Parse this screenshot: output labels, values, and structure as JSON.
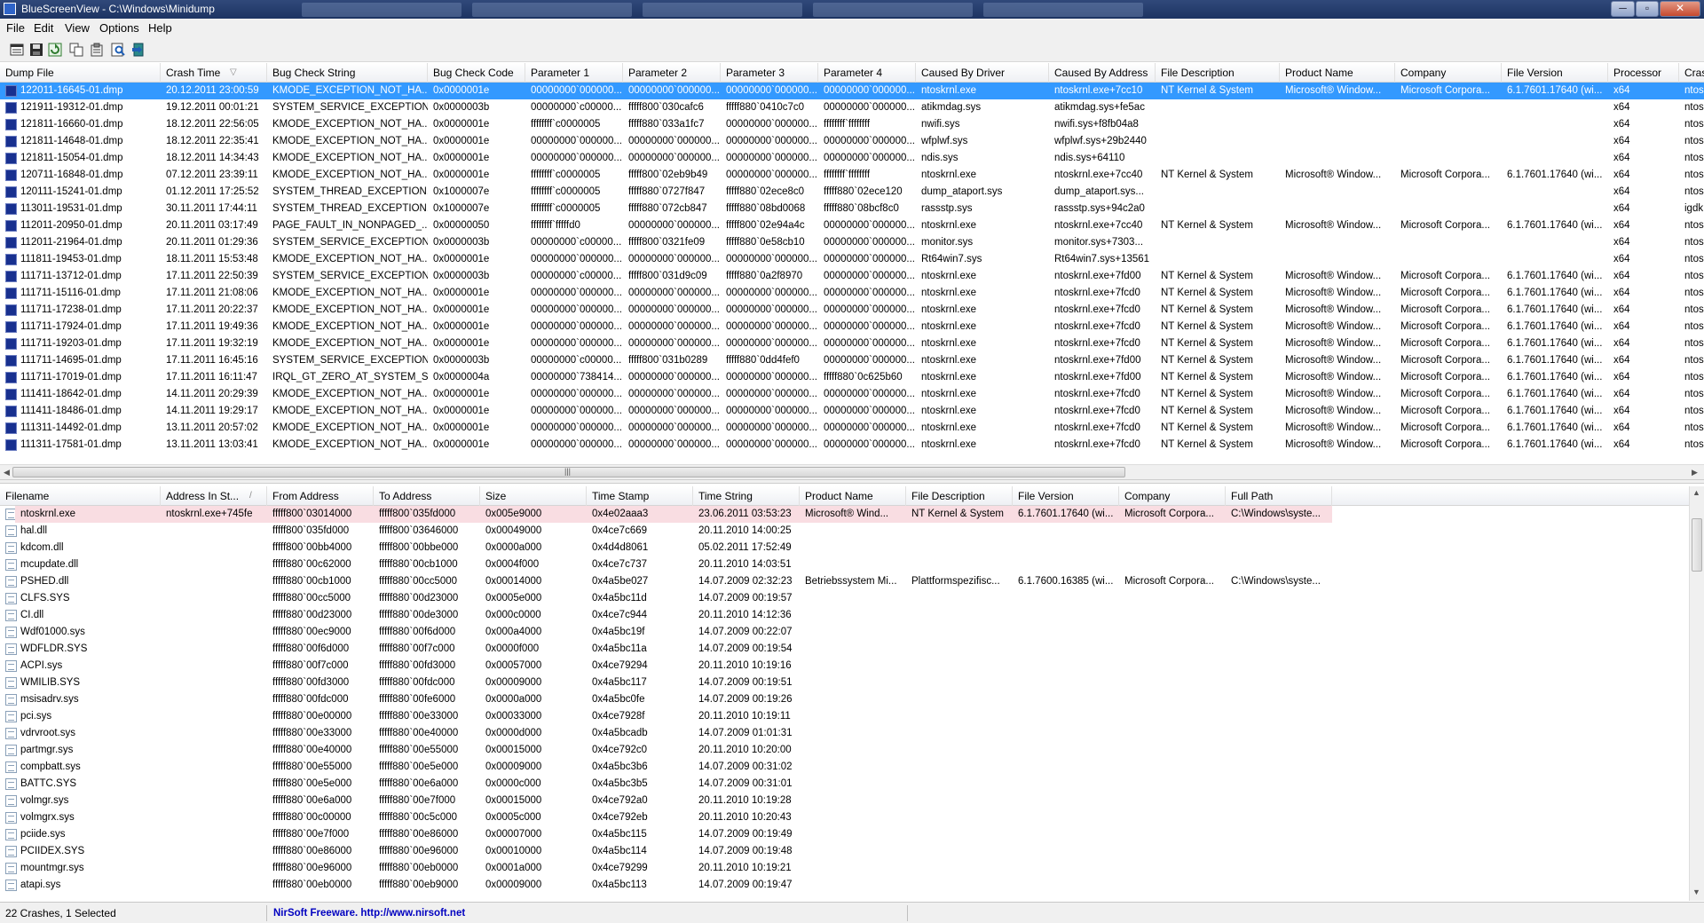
{
  "window": {
    "app_name": "BlueScreenView",
    "path": "C:\\Windows\\Minidump",
    "title_sep": " - "
  },
  "menu": [
    "File",
    "Edit",
    "View",
    "Options",
    "Help"
  ],
  "toolbar": [
    "save-html-report-icon",
    "save-icon",
    "refresh-icon",
    "copy-icon",
    "properties-icon",
    "find-icon",
    "exit-icon"
  ],
  "top_list": {
    "columns": [
      "Dump File",
      "Crash Time",
      "Bug Check String",
      "Bug Check Code",
      "Parameter 1",
      "Parameter 2",
      "Parameter 3",
      "Parameter 4",
      "Caused By Driver",
      "Caused By Address",
      "File Description",
      "Product Name",
      "Company",
      "File Version",
      "Processor",
      "Cras"
    ],
    "sort_indicator": "▽",
    "rows": [
      [
        "122011-16645-01.dmp",
        "20.12.2011 23:00:59",
        "KMODE_EXCEPTION_NOT_HA...",
        "0x0000001e",
        "00000000`000000...",
        "00000000`000000...",
        "00000000`000000...",
        "00000000`000000...",
        "ntoskrnl.exe",
        "ntoskrnl.exe+7cc10",
        "NT Kernel & System",
        "Microsoft® Window...",
        "Microsoft Corpora...",
        "6.1.7601.17640 (wi...",
        "x64",
        "ntos"
      ],
      [
        "121911-19312-01.dmp",
        "19.12.2011 00:01:21",
        "SYSTEM_SERVICE_EXCEPTION",
        "0x0000003b",
        "00000000`c00000...",
        "fffff800`030cafc6",
        "fffff880`0410c7c0",
        "00000000`000000...",
        "atikmdag.sys",
        "atikmdag.sys+fe5ac",
        "",
        "",
        "",
        "",
        "x64",
        "ntos"
      ],
      [
        "121811-16660-01.dmp",
        "18.12.2011 22:56:05",
        "KMODE_EXCEPTION_NOT_HA...",
        "0x0000001e",
        "ffffffff`c0000005",
        "fffff880`033a1fc7",
        "00000000`000000...",
        "ffffffff`ffffffff",
        "nwifi.sys",
        "nwifi.sys+f8fb04a8",
        "",
        "",
        "",
        "",
        "x64",
        "ntos"
      ],
      [
        "121811-14648-01.dmp",
        "18.12.2011 22:35:41",
        "KMODE_EXCEPTION_NOT_HA...",
        "0x0000001e",
        "00000000`000000...",
        "00000000`000000...",
        "00000000`000000...",
        "00000000`000000...",
        "wfplwf.sys",
        "wfplwf.sys+29b2440",
        "",
        "",
        "",
        "",
        "x64",
        "ntos"
      ],
      [
        "121811-15054-01.dmp",
        "18.12.2011 14:34:43",
        "KMODE_EXCEPTION_NOT_HA...",
        "0x0000001e",
        "00000000`000000...",
        "00000000`000000...",
        "00000000`000000...",
        "00000000`000000...",
        "ndis.sys",
        "ndis.sys+64110",
        "",
        "",
        "",
        "",
        "x64",
        "ntos"
      ],
      [
        "120711-16848-01.dmp",
        "07.12.2011 23:39:11",
        "KMODE_EXCEPTION_NOT_HA...",
        "0x0000001e",
        "ffffffff`c0000005",
        "fffff800`02eb9b49",
        "00000000`000000...",
        "ffffffff`ffffffff",
        "ntoskrnl.exe",
        "ntoskrnl.exe+7cc40",
        "NT Kernel & System",
        "Microsoft® Window...",
        "Microsoft Corpora...",
        "6.1.7601.17640 (wi...",
        "x64",
        "ntos"
      ],
      [
        "120111-15241-01.dmp",
        "01.12.2011 17:25:52",
        "SYSTEM_THREAD_EXCEPTION...",
        "0x1000007e",
        "ffffffff`c0000005",
        "fffff880`0727f847",
        "fffff880`02ece8c0",
        "fffff880`02ece120",
        "dump_ataport.sys",
        "dump_ataport.sys...",
        "",
        "",
        "",
        "",
        "x64",
        "ntos"
      ],
      [
        "113011-19531-01.dmp",
        "30.11.2011 17:44:11",
        "SYSTEM_THREAD_EXCEPTION...",
        "0x1000007e",
        "ffffffff`c0000005",
        "fffff880`072cb847",
        "fffff880`08bd0068",
        "fffff880`08bcf8c0",
        "rassstp.sys",
        "rassstp.sys+94c2a0",
        "",
        "",
        "",
        "",
        "x64",
        "igdk"
      ],
      [
        "112011-20950-01.dmp",
        "20.11.2011 03:17:49",
        "PAGE_FAULT_IN_NONPAGED_...",
        "0x00000050",
        "ffffffff`fffffd0",
        "00000000`000000...",
        "fffff800`02e94a4c",
        "00000000`000000...",
        "ntoskrnl.exe",
        "ntoskrnl.exe+7cc40",
        "NT Kernel & System",
        "Microsoft® Window...",
        "Microsoft Corpora...",
        "6.1.7601.17640 (wi...",
        "x64",
        "ntos"
      ],
      [
        "112011-21964-01.dmp",
        "20.11.2011 01:29:36",
        "SYSTEM_SERVICE_EXCEPTION",
        "0x0000003b",
        "00000000`c00000...",
        "fffff800`0321fe09",
        "fffff880`0e58cb10",
        "00000000`000000...",
        "monitor.sys",
        "monitor.sys+7303...",
        "",
        "",
        "",
        "",
        "x64",
        "ntos"
      ],
      [
        "111811-19453-01.dmp",
        "18.11.2011 15:53:48",
        "KMODE_EXCEPTION_NOT_HA...",
        "0x0000001e",
        "00000000`000000...",
        "00000000`000000...",
        "00000000`000000...",
        "00000000`000000...",
        "Rt64win7.sys",
        "Rt64win7.sys+13561",
        "",
        "",
        "",
        "",
        "x64",
        "ntos"
      ],
      [
        "111711-13712-01.dmp",
        "17.11.2011 22:50:39",
        "SYSTEM_SERVICE_EXCEPTION",
        "0x0000003b",
        "00000000`c00000...",
        "fffff800`031d9c09",
        "fffff880`0a2f8970",
        "00000000`000000...",
        "ntoskrnl.exe",
        "ntoskrnl.exe+7fd00",
        "NT Kernel & System",
        "Microsoft® Window...",
        "Microsoft Corpora...",
        "6.1.7601.17640 (wi...",
        "x64",
        "ntos"
      ],
      [
        "111711-15116-01.dmp",
        "17.11.2011 21:08:06",
        "KMODE_EXCEPTION_NOT_HA...",
        "0x0000001e",
        "00000000`000000...",
        "00000000`000000...",
        "00000000`000000...",
        "00000000`000000...",
        "ntoskrnl.exe",
        "ntoskrnl.exe+7fcd0",
        "NT Kernel & System",
        "Microsoft® Window...",
        "Microsoft Corpora...",
        "6.1.7601.17640 (wi...",
        "x64",
        "ntos"
      ],
      [
        "111711-17238-01.dmp",
        "17.11.2011 20:22:37",
        "KMODE_EXCEPTION_NOT_HA...",
        "0x0000001e",
        "00000000`000000...",
        "00000000`000000...",
        "00000000`000000...",
        "00000000`000000...",
        "ntoskrnl.exe",
        "ntoskrnl.exe+7fcd0",
        "NT Kernel & System",
        "Microsoft® Window...",
        "Microsoft Corpora...",
        "6.1.7601.17640 (wi...",
        "x64",
        "ntos"
      ],
      [
        "111711-17924-01.dmp",
        "17.11.2011 19:49:36",
        "KMODE_EXCEPTION_NOT_HA...",
        "0x0000001e",
        "00000000`000000...",
        "00000000`000000...",
        "00000000`000000...",
        "00000000`000000...",
        "ntoskrnl.exe",
        "ntoskrnl.exe+7fcd0",
        "NT Kernel & System",
        "Microsoft® Window...",
        "Microsoft Corpora...",
        "6.1.7601.17640 (wi...",
        "x64",
        "ntos"
      ],
      [
        "111711-19203-01.dmp",
        "17.11.2011 19:32:19",
        "KMODE_EXCEPTION_NOT_HA...",
        "0x0000001e",
        "00000000`000000...",
        "00000000`000000...",
        "00000000`000000...",
        "00000000`000000...",
        "ntoskrnl.exe",
        "ntoskrnl.exe+7fcd0",
        "NT Kernel & System",
        "Microsoft® Window...",
        "Microsoft Corpora...",
        "6.1.7601.17640 (wi...",
        "x64",
        "ntos"
      ],
      [
        "111711-14695-01.dmp",
        "17.11.2011 16:45:16",
        "SYSTEM_SERVICE_EXCEPTION",
        "0x0000003b",
        "00000000`c00000...",
        "fffff800`031b0289",
        "fffff880`0dd4fef0",
        "00000000`000000...",
        "ntoskrnl.exe",
        "ntoskrnl.exe+7fd00",
        "NT Kernel & System",
        "Microsoft® Window...",
        "Microsoft Corpora...",
        "6.1.7601.17640 (wi...",
        "x64",
        "ntos"
      ],
      [
        "111711-17019-01.dmp",
        "17.11.2011 16:11:47",
        "IRQL_GT_ZERO_AT_SYSTEM_S...",
        "0x0000004a",
        "00000000`738414...",
        "00000000`000000...",
        "00000000`000000...",
        "fffff880`0c625b60",
        "ntoskrnl.exe",
        "ntoskrnl.exe+7fd00",
        "NT Kernel & System",
        "Microsoft® Window...",
        "Microsoft Corpora...",
        "6.1.7601.17640 (wi...",
        "x64",
        "ntos"
      ],
      [
        "111411-18642-01.dmp",
        "14.11.2011 20:29:39",
        "KMODE_EXCEPTION_NOT_HA...",
        "0x0000001e",
        "00000000`000000...",
        "00000000`000000...",
        "00000000`000000...",
        "00000000`000000...",
        "ntoskrnl.exe",
        "ntoskrnl.exe+7fcd0",
        "NT Kernel & System",
        "Microsoft® Window...",
        "Microsoft Corpora...",
        "6.1.7601.17640 (wi...",
        "x64",
        "ntos"
      ],
      [
        "111411-18486-01.dmp",
        "14.11.2011 19:29:17",
        "KMODE_EXCEPTION_NOT_HA...",
        "0x0000001e",
        "00000000`000000...",
        "00000000`000000...",
        "00000000`000000...",
        "00000000`000000...",
        "ntoskrnl.exe",
        "ntoskrnl.exe+7fcd0",
        "NT Kernel & System",
        "Microsoft® Window...",
        "Microsoft Corpora...",
        "6.1.7601.17640 (wi...",
        "x64",
        "ntos"
      ],
      [
        "111311-14492-01.dmp",
        "13.11.2011 20:57:02",
        "KMODE_EXCEPTION_NOT_HA...",
        "0x0000001e",
        "00000000`000000...",
        "00000000`000000...",
        "00000000`000000...",
        "00000000`000000...",
        "ntoskrnl.exe",
        "ntoskrnl.exe+7fcd0",
        "NT Kernel & System",
        "Microsoft® Window...",
        "Microsoft Corpora...",
        "6.1.7601.17640 (wi...",
        "x64",
        "ntos"
      ],
      [
        "111311-17581-01.dmp",
        "13.11.2011 13:03:41",
        "KMODE_EXCEPTION_NOT_HA...",
        "0x0000001e",
        "00000000`000000...",
        "00000000`000000...",
        "00000000`000000...",
        "00000000`000000...",
        "ntoskrnl.exe",
        "ntoskrnl.exe+7fcd0",
        "NT Kernel & System",
        "Microsoft® Window...",
        "Microsoft Corpora...",
        "6.1.7601.17640 (wi...",
        "x64",
        "ntos"
      ]
    ]
  },
  "bottom_list": {
    "columns": [
      "Filename",
      "Address In St...",
      "From Address",
      "To Address",
      "Size",
      "Time Stamp",
      "Time String",
      "Product Name",
      "File Description",
      "File Version",
      "Company",
      "Full Path"
    ],
    "sort_indicator": "/",
    "rows": [
      [
        "ntoskrnl.exe",
        "ntoskrnl.exe+745fe",
        "fffff800`03014000",
        "fffff800`035fd000",
        "0x005e9000",
        "0x4e02aaa3",
        "23.06.2011 03:53:23",
        "Microsoft® Wind...",
        "NT Kernel & System",
        "6.1.7601.17640 (wi...",
        "Microsoft Corpora...",
        "C:\\Windows\\syste..."
      ],
      [
        "hal.dll",
        "",
        "fffff800`035fd000",
        "fffff800`03646000",
        "0x00049000",
        "0x4ce7c669",
        "20.11.2010 14:00:25",
        "",
        "",
        "",
        "",
        ""
      ],
      [
        "kdcom.dll",
        "",
        "fffff800`00bb4000",
        "fffff800`00bbe000",
        "0x0000a000",
        "0x4d4d8061",
        "05.02.2011 17:52:49",
        "",
        "",
        "",
        "",
        ""
      ],
      [
        "mcupdate.dll",
        "",
        "fffff880`00c62000",
        "fffff880`00cb1000",
        "0x0004f000",
        "0x4ce7c737",
        "20.11.2010 14:03:51",
        "",
        "",
        "",
        "",
        ""
      ],
      [
        "PSHED.dll",
        "",
        "fffff880`00cb1000",
        "fffff880`00cc5000",
        "0x00014000",
        "0x4a5be027",
        "14.07.2009 02:32:23",
        "Betriebssystem Mi...",
        "Plattformspezifisc...",
        "6.1.7600.16385 (wi...",
        "Microsoft Corpora...",
        "C:\\Windows\\syste..."
      ],
      [
        "CLFS.SYS",
        "",
        "fffff880`00cc5000",
        "fffff880`00d23000",
        "0x0005e000",
        "0x4a5bc11d",
        "14.07.2009 00:19:57",
        "",
        "",
        "",
        "",
        ""
      ],
      [
        "CI.dll",
        "",
        "fffff880`00d23000",
        "fffff880`00de3000",
        "0x000c0000",
        "0x4ce7c944",
        "20.11.2010 14:12:36",
        "",
        "",
        "",
        "",
        ""
      ],
      [
        "Wdf01000.sys",
        "",
        "fffff880`00ec9000",
        "fffff880`00f6d000",
        "0x000a4000",
        "0x4a5bc19f",
        "14.07.2009 00:22:07",
        "",
        "",
        "",
        "",
        ""
      ],
      [
        "WDFLDR.SYS",
        "",
        "fffff880`00f6d000",
        "fffff880`00f7c000",
        "0x0000f000",
        "0x4a5bc11a",
        "14.07.2009 00:19:54",
        "",
        "",
        "",
        "",
        ""
      ],
      [
        "ACPI.sys",
        "",
        "fffff880`00f7c000",
        "fffff880`00fd3000",
        "0x00057000",
        "0x4ce79294",
        "20.11.2010 10:19:16",
        "",
        "",
        "",
        "",
        ""
      ],
      [
        "WMILIB.SYS",
        "",
        "fffff880`00fd3000",
        "fffff880`00fdc000",
        "0x00009000",
        "0x4a5bc117",
        "14.07.2009 00:19:51",
        "",
        "",
        "",
        "",
        ""
      ],
      [
        "msisadrv.sys",
        "",
        "fffff880`00fdc000",
        "fffff880`00fe6000",
        "0x0000a000",
        "0x4a5bc0fe",
        "14.07.2009 00:19:26",
        "",
        "",
        "",
        "",
        ""
      ],
      [
        "pci.sys",
        "",
        "fffff880`00e00000",
        "fffff880`00e33000",
        "0x00033000",
        "0x4ce7928f",
        "20.11.2010 10:19:11",
        "",
        "",
        "",
        "",
        ""
      ],
      [
        "vdrvroot.sys",
        "",
        "fffff880`00e33000",
        "fffff880`00e40000",
        "0x0000d000",
        "0x4a5bcadb",
        "14.07.2009 01:01:31",
        "",
        "",
        "",
        "",
        ""
      ],
      [
        "partmgr.sys",
        "",
        "fffff880`00e40000",
        "fffff880`00e55000",
        "0x00015000",
        "0x4ce792c0",
        "20.11.2010 10:20:00",
        "",
        "",
        "",
        "",
        ""
      ],
      [
        "compbatt.sys",
        "",
        "fffff880`00e55000",
        "fffff880`00e5e000",
        "0x00009000",
        "0x4a5bc3b6",
        "14.07.2009 00:31:02",
        "",
        "",
        "",
        "",
        ""
      ],
      [
        "BATTC.SYS",
        "",
        "fffff880`00e5e000",
        "fffff880`00e6a000",
        "0x0000c000",
        "0x4a5bc3b5",
        "14.07.2009 00:31:01",
        "",
        "",
        "",
        "",
        ""
      ],
      [
        "volmgr.sys",
        "",
        "fffff880`00e6a000",
        "fffff880`00e7f000",
        "0x00015000",
        "0x4ce792a0",
        "20.11.2010 10:19:28",
        "",
        "",
        "",
        "",
        ""
      ],
      [
        "volmgrx.sys",
        "",
        "fffff880`00c00000",
        "fffff880`00c5c000",
        "0x0005c000",
        "0x4ce792eb",
        "20.11.2010 10:20:43",
        "",
        "",
        "",
        "",
        ""
      ],
      [
        "pciide.sys",
        "",
        "fffff880`00e7f000",
        "fffff880`00e86000",
        "0x00007000",
        "0x4a5bc115",
        "14.07.2009 00:19:49",
        "",
        "",
        "",
        "",
        ""
      ],
      [
        "PCIIDEX.SYS",
        "",
        "fffff880`00e86000",
        "fffff880`00e96000",
        "0x00010000",
        "0x4a5bc114",
        "14.07.2009 00:19:48",
        "",
        "",
        "",
        "",
        ""
      ],
      [
        "mountmgr.sys",
        "",
        "fffff880`00e96000",
        "fffff880`00eb0000",
        "0x0001a000",
        "0x4ce79299",
        "20.11.2010 10:19:21",
        "",
        "",
        "",
        "",
        ""
      ],
      [
        "atapi.sys",
        "",
        "fffff880`00eb0000",
        "fffff880`00eb9000",
        "0x00009000",
        "0x4a5bc113",
        "14.07.2009 00:19:47",
        "",
        "",
        "",
        "",
        ""
      ]
    ]
  },
  "status": {
    "summary": "22 Crashes, 1 Selected",
    "nirsoft": "NirSoft Freeware.  http://www.nirsoft.net"
  },
  "colors": {
    "selection": "#3399ff",
    "highlight_row": "#f9dde2",
    "nirsoft_text": "#0000c0"
  }
}
